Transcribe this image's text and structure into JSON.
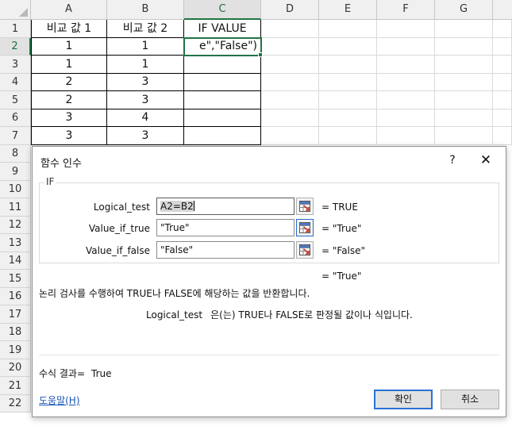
{
  "sheet": {
    "columns": [
      "A",
      "B",
      "C",
      "D",
      "E",
      "F",
      "G"
    ],
    "rows": [
      "1",
      "2",
      "3",
      "4",
      "5",
      "6",
      "7",
      "8",
      "9",
      "10",
      "11",
      "12",
      "13",
      "14",
      "15",
      "16",
      "17",
      "18",
      "19",
      "20",
      "21",
      "22"
    ],
    "header": {
      "a": "비교 값 1",
      "b": "비교 값 2",
      "c": "IF VALUE"
    },
    "data": [
      {
        "a": "1",
        "b": "1",
        "c": "e\",\"False\")"
      },
      {
        "a": "1",
        "b": "1",
        "c": ""
      },
      {
        "a": "2",
        "b": "3",
        "c": ""
      },
      {
        "a": "2",
        "b": "3",
        "c": ""
      },
      {
        "a": "3",
        "b": "4",
        "c": ""
      },
      {
        "a": "3",
        "b": "3",
        "c": ""
      }
    ]
  },
  "dialog": {
    "title": "함수 인수",
    "help_glyph": "?",
    "close_glyph": "✕",
    "function_name": "IF",
    "args": [
      {
        "label": "Logical_test",
        "value": "A2=B2",
        "result": "=  TRUE"
      },
      {
        "label": "Value_if_true",
        "value": "\"True\"",
        "result": "=  \"True\""
      },
      {
        "label": "Value_if_false",
        "value": "\"False\"",
        "result": "=  \"False\""
      }
    ],
    "overall_result": "=  \"True\"",
    "function_description": "논리 검사를 수행하여 TRUE나 FALSE에 해당하는 값을 반환합니다.",
    "arg_description_name": "Logical_test",
    "arg_description_text": "은(는) TRUE나 FALSE로 판정될 값이나 식입니다.",
    "formula_result_label": "수식 결과=",
    "formula_result_value": "True",
    "help_link": "도움말(H)",
    "ok_label": "확인",
    "cancel_label": "취소",
    "accent_color": "#2a72d6",
    "picker_icon": "range-select-icon"
  },
  "colors": {
    "excel_green": "#217346"
  }
}
